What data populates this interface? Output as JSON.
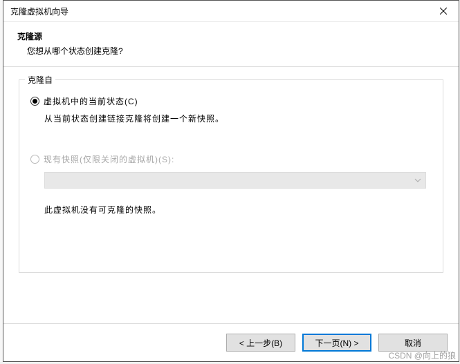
{
  "window": {
    "title": "克隆虚拟机向导"
  },
  "header": {
    "title": "克隆源",
    "subtitle": "您想从哪个状态创建克隆?"
  },
  "group": {
    "legend": "克隆自",
    "option1": {
      "label": "虚拟机中的当前状态(C)",
      "hint": "从当前状态创建链接克隆将创建一个新快照。"
    },
    "option2": {
      "label": "现有快照(仅限关闭的虚拟机)(S):",
      "hint": "此虚拟机没有可克隆的快照。"
    }
  },
  "footer": {
    "back": "< 上一步(B)",
    "next": "下一页(N) >",
    "cancel": "取消"
  },
  "watermark": "CSDN @向上的狼"
}
